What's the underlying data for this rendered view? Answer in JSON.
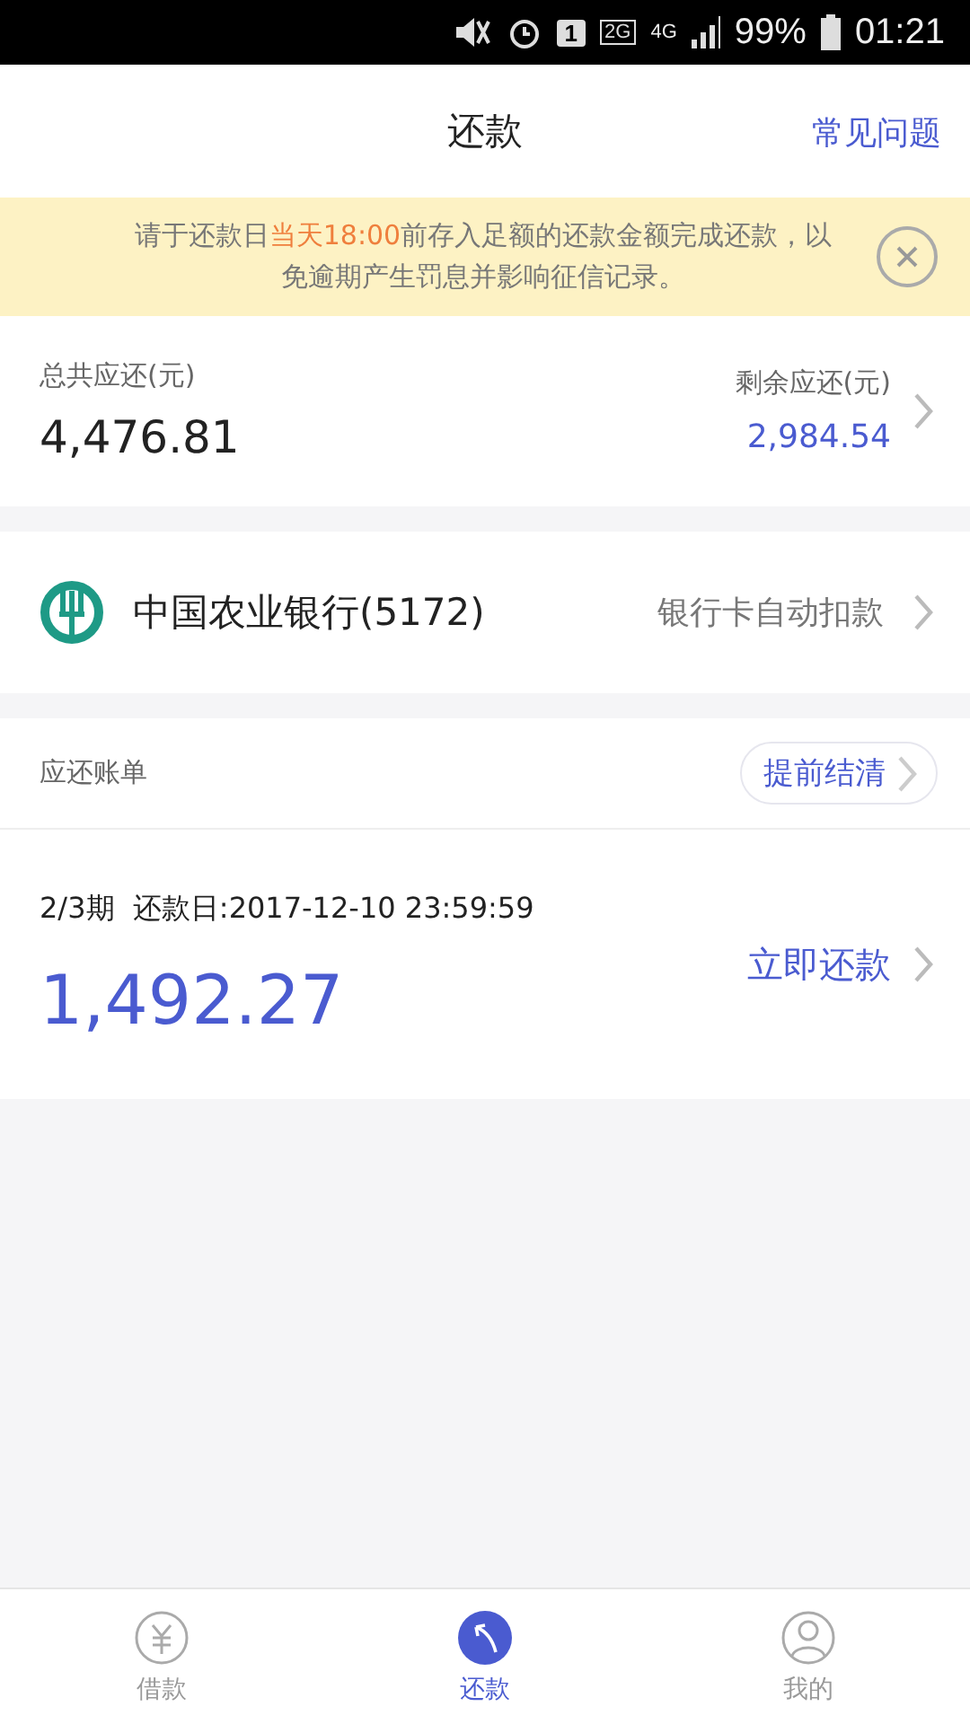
{
  "status_bar": {
    "sim_slot": "1",
    "network_2g": "2G",
    "network_4g": "4G",
    "battery": "99%",
    "time": "01:21"
  },
  "header": {
    "title": "还款",
    "help_link": "常见问题"
  },
  "notice": {
    "text": "请于还款日**当天18:00**前存入足额的还款金额完成还款，以免逾期产生罚息并影响征信记录。"
  },
  "summary": {
    "total_label": "总共应还(元)",
    "total_amount": "4,476.81",
    "remaining_label": "剩余应还(元)",
    "remaining_amount": "2,984.54"
  },
  "bank_card": {
    "name": "中国农业银行(5172)",
    "method": "银行卡自动扣款"
  },
  "bills": {
    "title": "应还账单",
    "early_payoff": "提前结清",
    "items": [
      {
        "period": "2/3期",
        "due": "还款日:2017-12-10 23:59:59",
        "amount": "1,492.27",
        "action": "立即还款"
      }
    ]
  },
  "tab_bar": [
    {
      "kind": "loan",
      "label": "借款",
      "selected": false
    },
    {
      "kind": "repay",
      "label": "还款",
      "selected": true
    },
    {
      "kind": "profile",
      "label": "我的",
      "selected": false
    }
  ]
}
